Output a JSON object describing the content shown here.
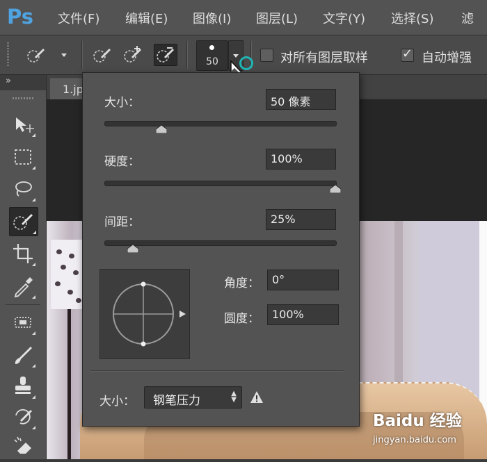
{
  "app": {
    "logo": "Ps"
  },
  "menu": {
    "items": [
      "文件(F)",
      "编辑(E)",
      "图像(I)",
      "图层(L)",
      "文字(Y)",
      "选择(S)",
      "滤"
    ]
  },
  "options_bar": {
    "brush_size_value": "50",
    "sample_all_layers": {
      "label": "对所有图层取样",
      "checked": false
    },
    "auto_enhance": {
      "label": "自动增强",
      "checked": true
    }
  },
  "tools_panel": {
    "collapse_label": "»"
  },
  "document": {
    "tab_label": "1.jp"
  },
  "brush_popover": {
    "size": {
      "label": "大小：",
      "value": "50 像素",
      "slider_fraction": 0.25
    },
    "hardness": {
      "label": "硬度：",
      "value": "100%",
      "slider_fraction": 1.0
    },
    "spacing": {
      "label": "间距：",
      "value": "25%",
      "slider_fraction": 0.12
    },
    "angle": {
      "label": "角度：",
      "value": "0°"
    },
    "roundness": {
      "label": "圆度：",
      "value": "100%"
    },
    "size_control": {
      "label": "大小：",
      "selected": "钢笔压力"
    }
  },
  "watermark": {
    "logo": "Baidu 经验",
    "url": "jingyan.baidu.com"
  },
  "colors": {
    "accent_ring": "#20b5b5",
    "ps_blue": "#4fa3e0"
  }
}
